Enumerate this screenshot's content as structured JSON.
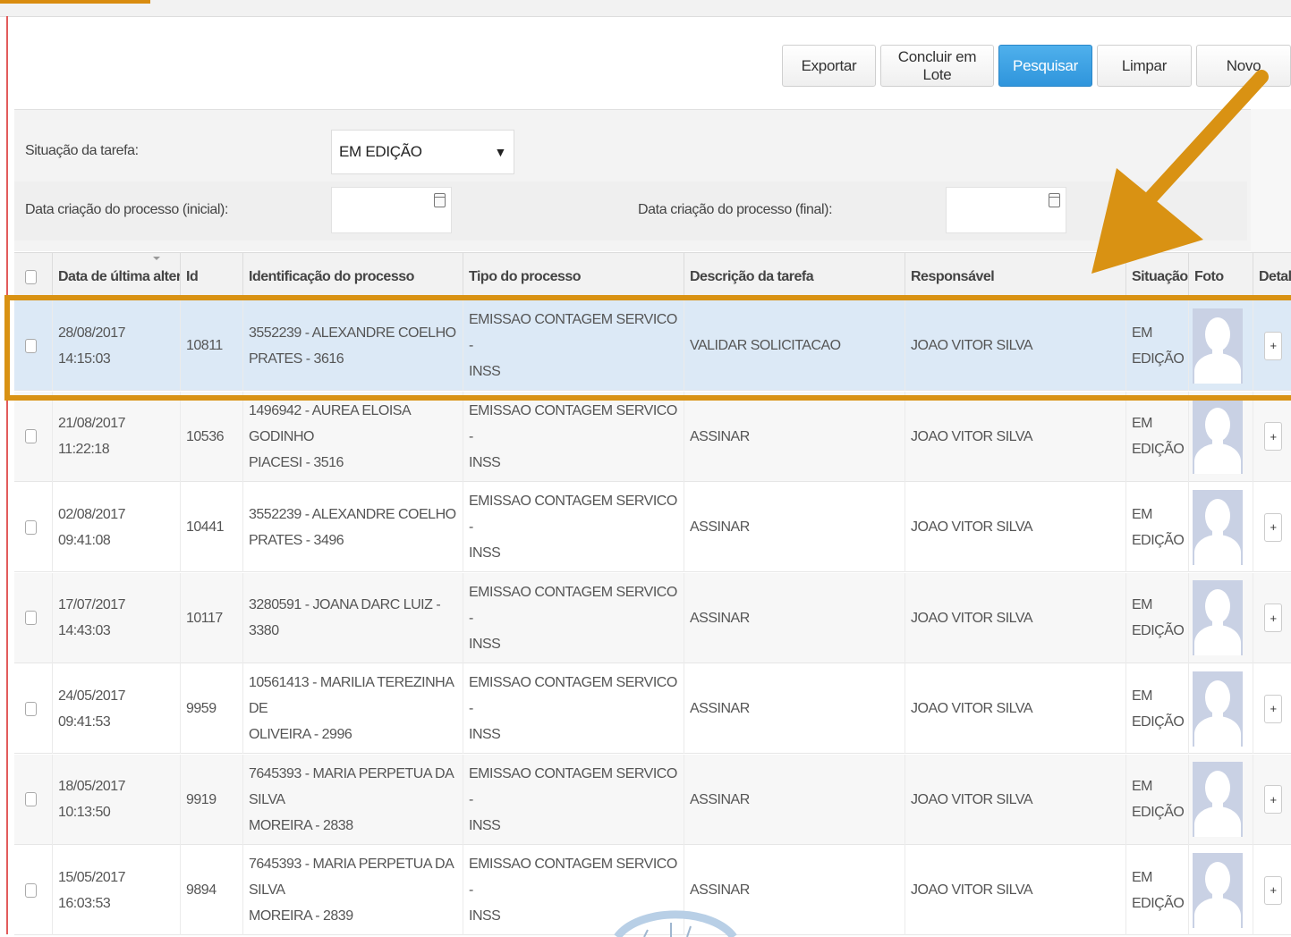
{
  "toolbar": {
    "export_label": "Exportar",
    "batch_label": "Concluir em Lote",
    "search_label": "Pesquisar",
    "clear_label": "Limpar",
    "new_label": "Novo"
  },
  "filters": {
    "status_label": "Situação da tarefa:",
    "status_value": "EM EDIÇÃO",
    "date_start_label": "Data criação do processo (inicial):",
    "date_end_label": "Data criação do processo (final):"
  },
  "table": {
    "headers": {
      "date": "Data de última alteraçã",
      "id": "Id",
      "process": "Identificação do processo",
      "type": "Tipo do processo",
      "task": "Descrição da tarefa",
      "owner": "Responsável",
      "status": "Situação",
      "photo": "Foto",
      "detail": "Detalh"
    },
    "rows": [
      {
        "date": "28/08/2017 14:15:03",
        "id": "10811",
        "process_1": "3552239 - ALEXANDRE COELHO",
        "process_2": "PRATES - 3616",
        "type_1": "EMISSAO CONTAGEM SERVICO -",
        "type_2": "INSS",
        "task": "VALIDAR SOLICITACAO",
        "owner": "JOAO VITOR SILVA",
        "status_1": "EM",
        "status_2": "EDIÇÃO",
        "detail": "+"
      },
      {
        "date": "21/08/2017 11:22:18",
        "id": "10536",
        "process_1": "1496942 - AUREA ELOISA GODINHO",
        "process_2": "PIACESI - 3516",
        "type_1": "EMISSAO CONTAGEM SERVICO -",
        "type_2": "INSS",
        "task": "ASSINAR",
        "owner": "JOAO VITOR SILVA",
        "status_1": "EM",
        "status_2": "EDIÇÃO",
        "detail": "+"
      },
      {
        "date": "02/08/2017 09:41:08",
        "id": "10441",
        "process_1": "3552239 - ALEXANDRE COELHO",
        "process_2": "PRATES - 3496",
        "type_1": "EMISSAO CONTAGEM SERVICO -",
        "type_2": "INSS",
        "task": "ASSINAR",
        "owner": "JOAO VITOR SILVA",
        "status_1": "EM",
        "status_2": "EDIÇÃO",
        "detail": "+"
      },
      {
        "date": "17/07/2017 14:43:03",
        "id": "10117",
        "process_1": "3280591 - JOANA DARC LUIZ - 3380",
        "process_2": "",
        "type_1": "EMISSAO CONTAGEM SERVICO -",
        "type_2": "INSS",
        "task": "ASSINAR",
        "owner": "JOAO VITOR SILVA",
        "status_1": "EM",
        "status_2": "EDIÇÃO",
        "detail": "+"
      },
      {
        "date": "24/05/2017 09:41:53",
        "id": "9959",
        "process_1": "10561413 - MARILIA TEREZINHA DE",
        "process_2": "OLIVEIRA - 2996",
        "type_1": "EMISSAO CONTAGEM SERVICO -",
        "type_2": "INSS",
        "task": "ASSINAR",
        "owner": "JOAO VITOR SILVA",
        "status_1": "EM",
        "status_2": "EDIÇÃO",
        "detail": "+"
      },
      {
        "date": "18/05/2017 10:13:50",
        "id": "9919",
        "process_1": "7645393 - MARIA PERPETUA DA SILVA",
        "process_2": "MOREIRA - 2838",
        "type_1": "EMISSAO CONTAGEM SERVICO -",
        "type_2": "INSS",
        "task": "ASSINAR",
        "owner": "JOAO VITOR SILVA",
        "status_1": "EM",
        "status_2": "EDIÇÃO",
        "detail": "+"
      },
      {
        "date": "15/05/2017 16:03:53",
        "id": "9894",
        "process_1": "7645393 - MARIA PERPETUA DA SILVA",
        "process_2": "MOREIRA - 2839",
        "type_1": "EMISSAO CONTAGEM SERVICO -",
        "type_2": "INSS",
        "task": "ASSINAR",
        "owner": "JOAO VITOR SILVA",
        "status_1": "EM",
        "status_2": "EDIÇÃO",
        "detail": "+"
      }
    ]
  },
  "colors": {
    "primary_button": "#2f95dc",
    "annotation": "#d99213",
    "selected_row": "#dce9f6"
  },
  "icons": {
    "dropdown": "caret-down-icon",
    "calendar": "calendar-icon",
    "avatar": "avatar-placeholder-icon"
  }
}
